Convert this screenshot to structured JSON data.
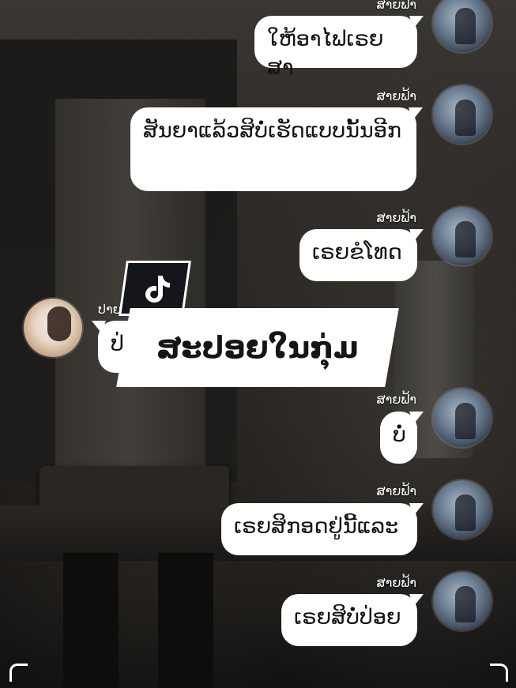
{
  "overlay": {
    "title": "ສະປອຍໃນກຸ່ມ",
    "logo_icon": "tiktok-logo-icon"
  },
  "messages": [
    {
      "sender": "ສາຍຟ້າ",
      "text": "ໃຫ້ອາໄຟເຣຍສາ",
      "side": "right"
    },
    {
      "sender": "ສາຍຟ້າ",
      "text": "ສັນຍາແລ້ວສິບໍ່ເຮັດແບບນັ້ນອີກ",
      "side": "right"
    },
    {
      "sender": "ສາຍຟ້າ",
      "text": "ເຣຍຂໍໂທດ",
      "side": "right"
    },
    {
      "sender": "ປາຍ",
      "text": "ປ່",
      "side": "left"
    },
    {
      "sender": "ສາຍຟ້າ",
      "text": "ບໍ່",
      "side": "right"
    },
    {
      "sender": "ສາຍຟ້າ",
      "text": "ເຣຍສິກອດຢູ່ນີ້ແລະ",
      "side": "right"
    },
    {
      "sender": "ສາຍຟ້າ",
      "text": "ເຣຍສິບໍ່ປ່ອຍ",
      "side": "right"
    }
  ]
}
